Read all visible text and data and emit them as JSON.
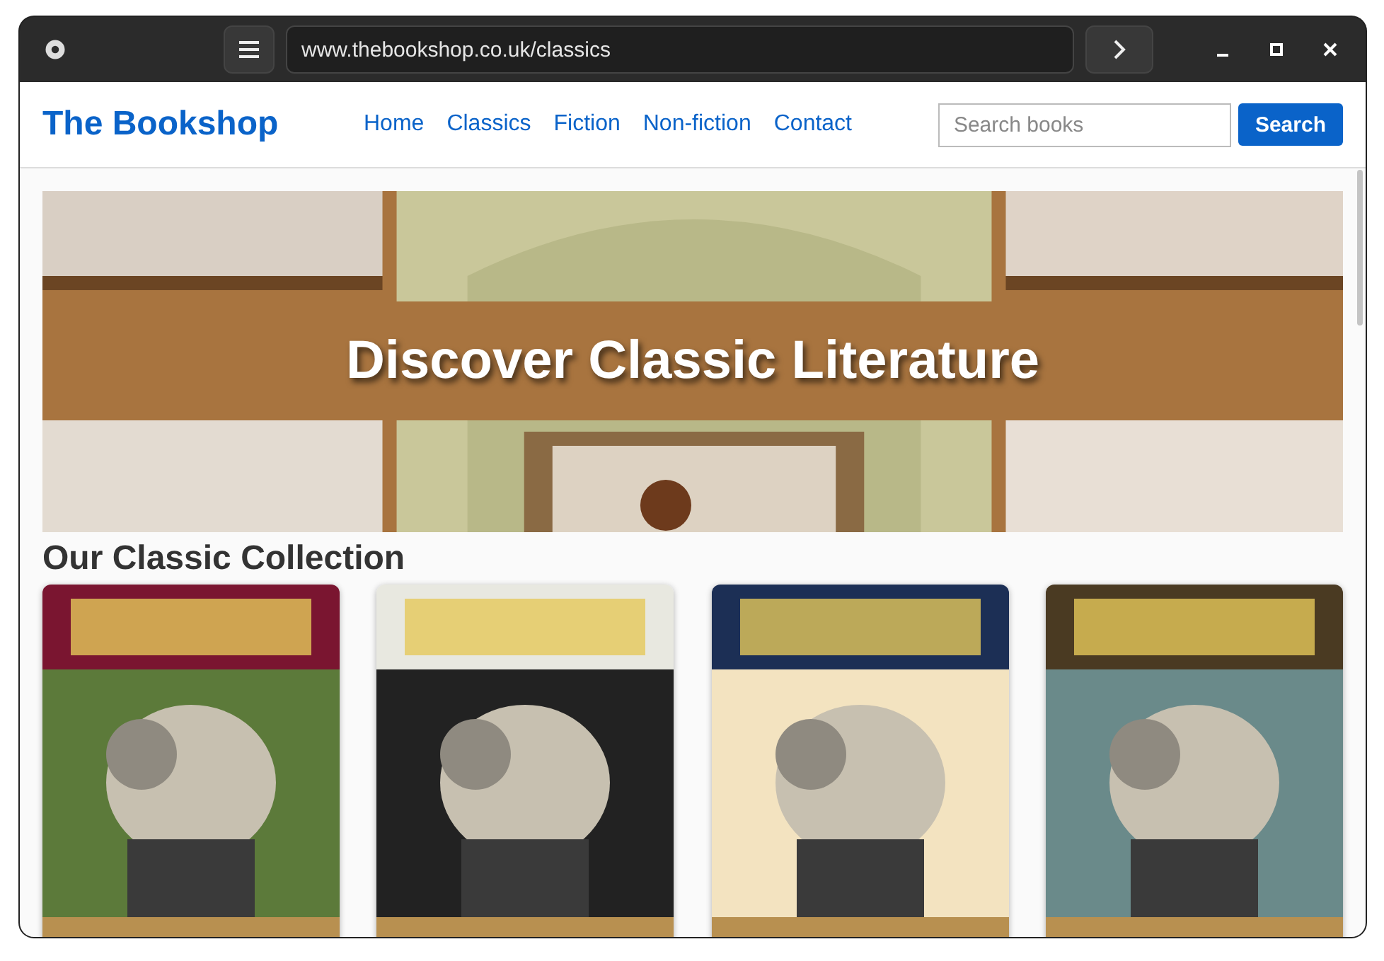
{
  "browser": {
    "url": "www.thebookshop.co.uk/classics"
  },
  "site": {
    "logo": "The Bookshop",
    "nav": [
      {
        "label": "Home"
      },
      {
        "label": "Classics"
      },
      {
        "label": "Fiction"
      },
      {
        "label": "Non-fiction"
      },
      {
        "label": "Contact"
      }
    ],
    "search": {
      "placeholder": "Search books",
      "button": "Search"
    }
  },
  "hero": {
    "kind": "picture",
    "title": "Discover Classic Literature"
  },
  "collection": {
    "title": "Our Classic Collection"
  }
}
